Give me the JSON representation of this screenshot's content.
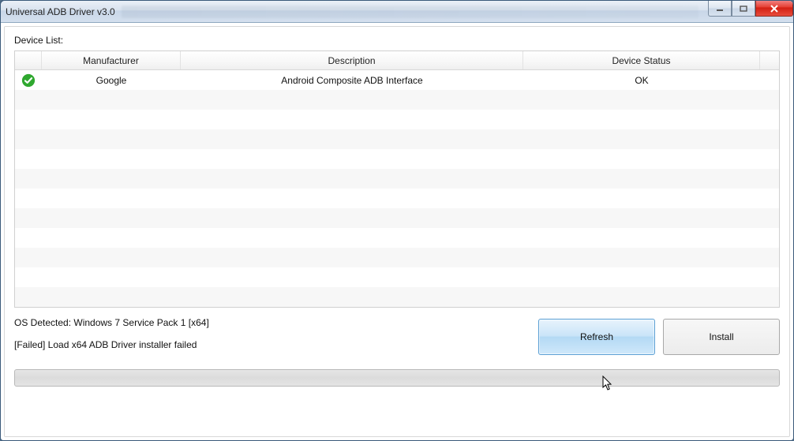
{
  "window": {
    "title": "Universal ADB Driver v3.0"
  },
  "labels": {
    "device_list": "Device List:"
  },
  "grid": {
    "headers": {
      "manufacturer": "Manufacturer",
      "description": "Description",
      "device_status": "Device Status"
    },
    "rows": [
      {
        "manufacturer": "Google",
        "description": "Android Composite ADB Interface",
        "status": "OK",
        "ok": true
      }
    ]
  },
  "status": {
    "os_line": "OS Detected: Windows 7 Service Pack 1 [x64]",
    "msg_line": "[Failed] Load x64 ADB Driver installer failed"
  },
  "buttons": {
    "refresh": "Refresh",
    "install": "Install"
  }
}
